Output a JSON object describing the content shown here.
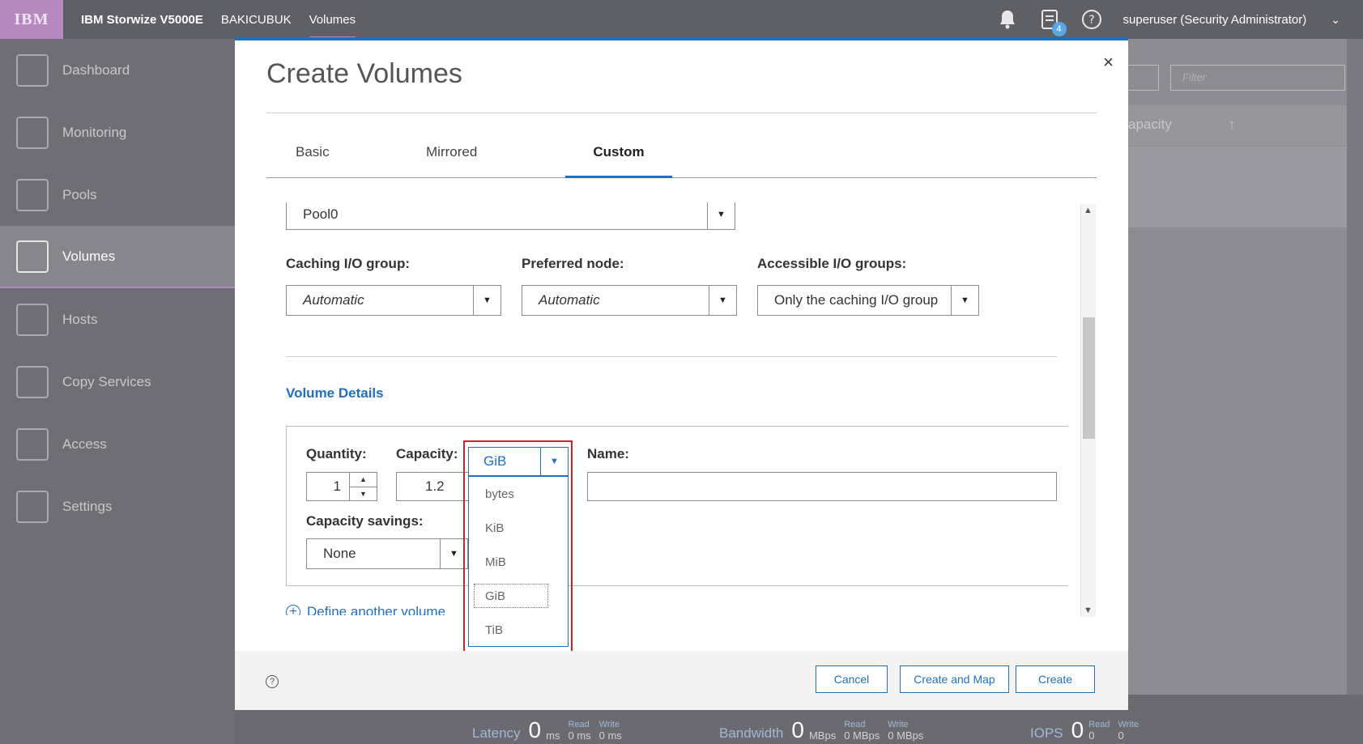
{
  "topbar": {
    "logo": "IBM",
    "product": "IBM Storwize V5000E",
    "system": "BAKICUBUK",
    "section": "Volumes",
    "tasks_count": "4",
    "user": "superuser (Security Administrator)"
  },
  "sidebar": {
    "items": [
      {
        "label": "Dashboard",
        "icon": "dashboard-icon"
      },
      {
        "label": "Monitoring",
        "icon": "monitoring-icon"
      },
      {
        "label": "Pools",
        "icon": "pools-icon"
      },
      {
        "label": "Volumes",
        "icon": "volumes-icon"
      },
      {
        "label": "Hosts",
        "icon": "hosts-icon"
      },
      {
        "label": "Copy Services",
        "icon": "copy-services-icon"
      },
      {
        "label": "Access",
        "icon": "access-icon"
      },
      {
        "label": "Settings",
        "icon": "settings-icon"
      }
    ]
  },
  "background_panel": {
    "filter_placeholder": "Filter",
    "column_header": "apacity"
  },
  "statusbar": {
    "latency": {
      "label": "Latency",
      "value": "0",
      "unit": "ms",
      "read_label": "Read",
      "read_value": "0 ms",
      "write_label": "Write",
      "write_value": "0 ms"
    },
    "bandwidth": {
      "label": "Bandwidth",
      "value": "0",
      "unit": "MBps",
      "read_label": "Read",
      "read_value": "0 MBps",
      "write_label": "Write",
      "write_value": "0 MBps"
    },
    "iops": {
      "label": "IOPS",
      "value": "0",
      "read_label": "Read",
      "read_value": "0",
      "write_label": "Write",
      "write_value": "0"
    }
  },
  "modal": {
    "title": "Create Volumes",
    "close": "×",
    "tabs": [
      "Basic",
      "Mirrored",
      "Custom"
    ],
    "active_tab": "Custom",
    "pool_value": "Pool0",
    "caching_label": "Caching I/O group:",
    "caching_value": "Automatic",
    "preferred_label": "Preferred node:",
    "preferred_value": "Automatic",
    "accessible_label": "Accessible I/O groups:",
    "accessible_value": "Only the caching I/O group",
    "volume_details_title": "Volume Details",
    "quantity_label": "Quantity:",
    "quantity_value": "1",
    "capacity_label": "Capacity:",
    "capacity_value": "1.2",
    "unit_value": "GiB",
    "unit_options": [
      "bytes",
      "KiB",
      "MiB",
      "GiB",
      "TiB"
    ],
    "name_label": "Name:",
    "name_value": "",
    "savings_label": "Capacity savings:",
    "savings_value": "None",
    "define_another": "Define another volume",
    "help": "?",
    "buttons": {
      "cancel": "Cancel",
      "create_map": "Create and Map",
      "create": "Create"
    }
  },
  "colors": {
    "accent": "#1f70c1",
    "highlight": "#d0202a",
    "logo_bg": "#b68ac0"
  }
}
